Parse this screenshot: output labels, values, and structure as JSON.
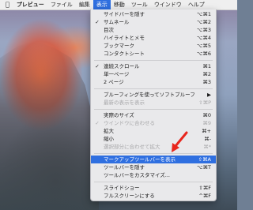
{
  "menubar": {
    "apple_icon": "apple-logo-icon",
    "items": [
      "プレビュー",
      "ファイル",
      "編集",
      "表示",
      "移動",
      "ツール",
      "ウインドウ",
      "ヘルプ"
    ],
    "active_item": "表示"
  },
  "view_menu": {
    "highlight_color": "#2f6fe0",
    "items": [
      {
        "label": "サイドバーを隠す",
        "shortcut": "⌥⌘1"
      },
      {
        "label": "サムネール",
        "shortcut": "⌥⌘2",
        "checked": true
      },
      {
        "label": "目次",
        "shortcut": "⌥⌘3"
      },
      {
        "label": "ハイライトとメモ",
        "shortcut": "⌥⌘4"
      },
      {
        "label": "ブックマーク",
        "shortcut": "⌥⌘5"
      },
      {
        "label": "コンタクトシート",
        "shortcut": "⌥⌘6"
      },
      {
        "label": "連続スクロール",
        "shortcut": "⌘1",
        "checked": true
      },
      {
        "label": "単一ページ",
        "shortcut": "⌘2"
      },
      {
        "label": "2 ページ",
        "shortcut": "⌘3"
      },
      {
        "label": "プルーフィングを使ってソフトプルーフ",
        "shortcut": "▶"
      },
      {
        "label": "最新の表示を表示",
        "shortcut": "⇧⌘P",
        "disabled": true
      },
      {
        "label": "実際のサイズ",
        "shortcut": "⌘0"
      },
      {
        "label": "ウインドウに合わせる",
        "shortcut": "⌘9",
        "disabled": true,
        "checked": true
      },
      {
        "label": "拡大",
        "shortcut": "⌘+"
      },
      {
        "label": "縮小",
        "shortcut": "⌘-"
      },
      {
        "label": "選択部分に合わせて拡大",
        "shortcut": "⌘*",
        "disabled": true
      },
      {
        "label": "マークアップツールバーを表示",
        "shortcut": "⇧⌘A",
        "highlighted": true
      },
      {
        "label": "ツールバーを隠す",
        "shortcut": "⌥⌘T"
      },
      {
        "label": "ツールバーをカスタマイズ..."
      },
      {
        "label": "スライドショー",
        "shortcut": "⇧⌘F"
      },
      {
        "label": "フルスクリーンにする",
        "shortcut": "^⌘F"
      }
    ]
  },
  "annotation": {
    "arrow_color": "#e8261d"
  }
}
